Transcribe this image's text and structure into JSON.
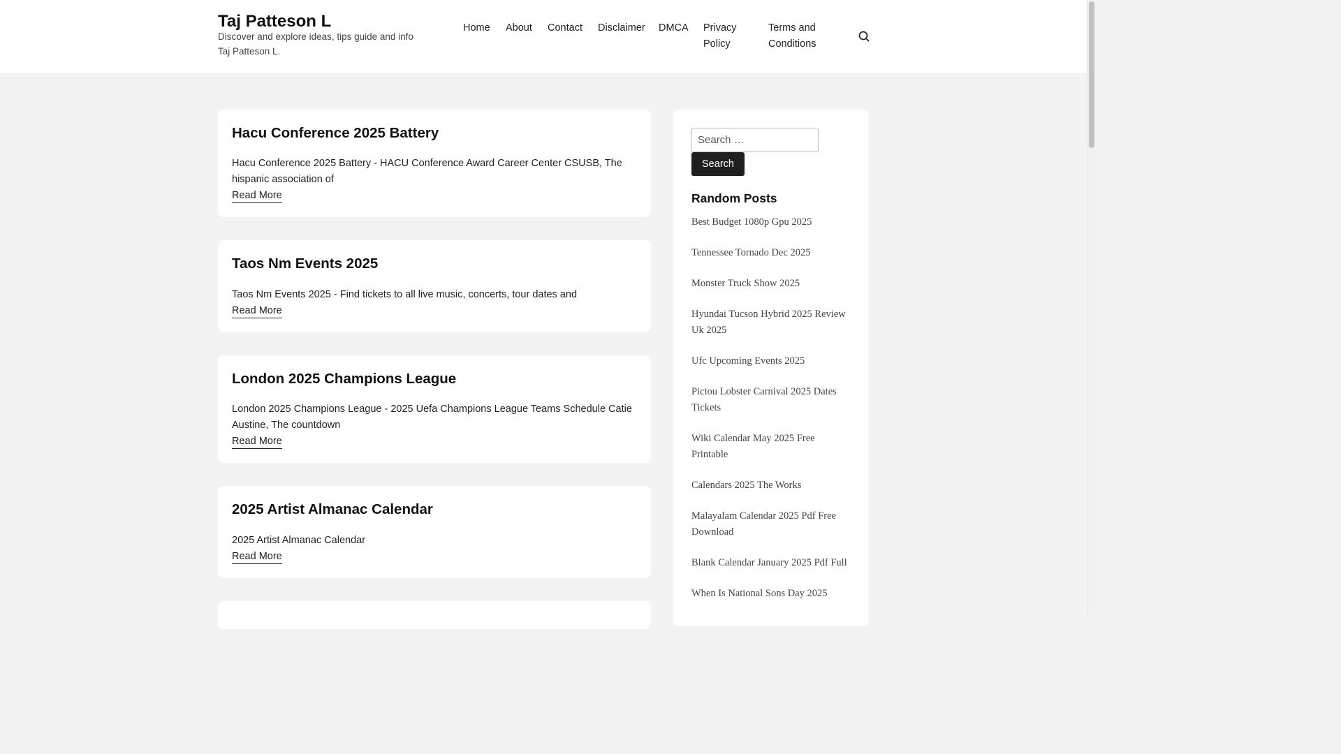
{
  "site": {
    "title": "Taj Patteson L",
    "tagline": "Discover and explore ideas, tips guide and info Taj Patteson L."
  },
  "nav": {
    "items": [
      {
        "label": "Home"
      },
      {
        "label": "About"
      },
      {
        "label": "Contact"
      },
      {
        "label": "Disclaimer"
      },
      {
        "label": "DMCA"
      },
      {
        "label": "Privacy Policy"
      },
      {
        "label": "Terms and Conditions"
      }
    ],
    "search_icon": "search-icon"
  },
  "posts": [
    {
      "title": "Hacu Conference 2025 Battery",
      "excerpt": "Hacu Conference 2025 Battery - HACU Conference Award Career Center CSUSB, The hispanic association of",
      "read_more": "Read More"
    },
    {
      "title": "Taos Nm Events 2025",
      "excerpt": "Taos Nm Events 2025 - Find tickets to all live music, concerts, tour dates and",
      "read_more": "Read More"
    },
    {
      "title": "London 2025 Champions League",
      "excerpt": "London 2025 Champions League - 2025 Uefa Champions League Teams Schedule Catie Austine, The countdown",
      "read_more": "Read More"
    },
    {
      "title": "2025 Artist Almanac Calendar",
      "excerpt": "2025 Artist Almanac Calendar",
      "read_more": "Read More"
    }
  ],
  "sidebar": {
    "search": {
      "placeholder": "Search …",
      "button_label": "Search"
    },
    "random_posts": {
      "heading": "Random Posts",
      "items": [
        "Best Budget 1080p Gpu 2025",
        "Tennessee Tornado Dec 2025",
        "Monster Truck Show 2025",
        "Hyundai Tucson Hybrid 2025 Review Uk 2025",
        "Ufc Upcoming Events 2025",
        "Pictou Lobster Carnival 2025 Dates Tickets",
        "Wiki Calendar May 2025 Free Printable",
        "Calendars 2025 The Works",
        "Malayalam Calendar 2025 Pdf Free Download",
        "Blank Calendar January 2025 Pdf Full",
        "When Is National Sons Day 2025"
      ]
    }
  }
}
